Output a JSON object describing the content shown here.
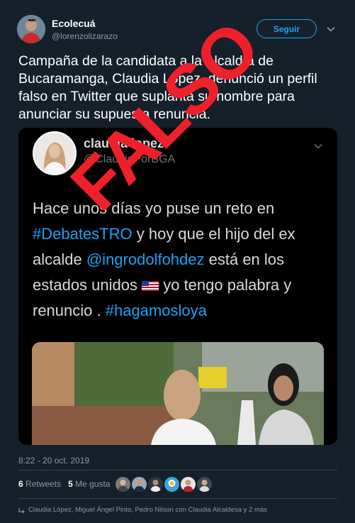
{
  "user": {
    "name": "Ecolecuá",
    "handle": "@lorenzolizarazo"
  },
  "follow_label": "Seguir",
  "tweet_text": "Campaña de la candidata a la Alcaldía de Bucaramanga, Claudia López, denunció un perfil falso en Twitter que suplanta su nombre para anunciar su supuesta renuncia.",
  "embedded": {
    "name": "claudia lopez",
    "handle": "@ClaudiaPorBGA",
    "t1": "Hace unos días yo puse un reto en ",
    "t2": "#DebatesTRO",
    "t3": " y hoy que el hijo del ex alcalde ",
    "t4": "@ingrodolfohdez",
    "t5": " está en los estados unidos ",
    "t6": " yo tengo palabra y renuncio . ",
    "t7": "#hagamosloya",
    "stamp": "FALSO"
  },
  "timestamp": "8:22 - 20 oct. 2019",
  "stats": {
    "retweets_count": "6",
    "retweets_label": "Retweets",
    "likes_count": "5",
    "likes_label": "Me gusta"
  },
  "reply_text": "Claudia López, Miguel Ángel Pinto, Pedro Nilson con Claudia Alcaldesa y 2 más",
  "colors": {
    "background": "#15202b",
    "accent": "#1da1f2",
    "stamp": "#f0202b"
  }
}
